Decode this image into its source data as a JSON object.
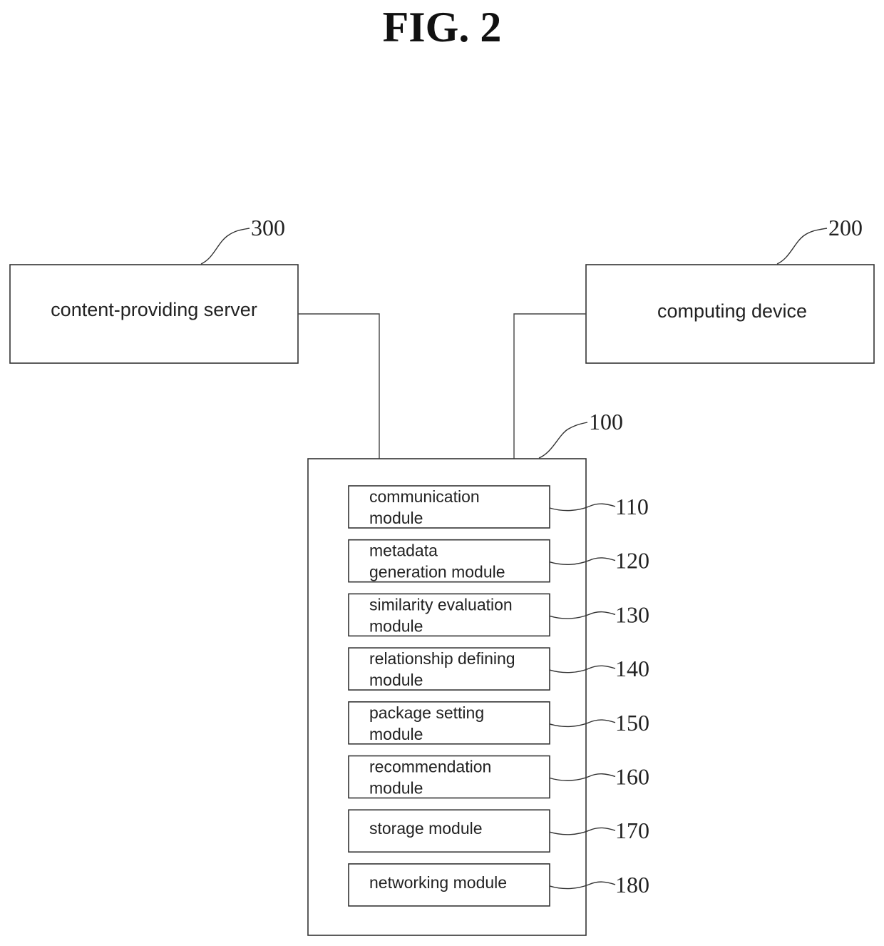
{
  "figure": {
    "title": "FIG. 2"
  },
  "nodes": {
    "content_server": {
      "ref": "300",
      "label": "content-providing server"
    },
    "computing_device": {
      "ref": "200",
      "label": "computing device"
    },
    "system": {
      "ref": "100"
    }
  },
  "modules": [
    {
      "ref": "110",
      "lines": [
        "communication",
        "module"
      ]
    },
    {
      "ref": "120",
      "lines": [
        "metadata",
        "generation module"
      ]
    },
    {
      "ref": "130",
      "lines": [
        "similarity evaluation",
        "module"
      ]
    },
    {
      "ref": "140",
      "lines": [
        "relationship defining",
        "module"
      ]
    },
    {
      "ref": "150",
      "lines": [
        "package setting",
        "module"
      ]
    },
    {
      "ref": "160",
      "lines": [
        "recommendation",
        "module"
      ]
    },
    {
      "ref": "170",
      "lines": [
        "storage module"
      ]
    },
    {
      "ref": "180",
      "lines": [
        "networking module"
      ]
    }
  ],
  "connections": [
    {
      "from": "300",
      "to": "100"
    },
    {
      "from": "200",
      "to": "100"
    }
  ]
}
